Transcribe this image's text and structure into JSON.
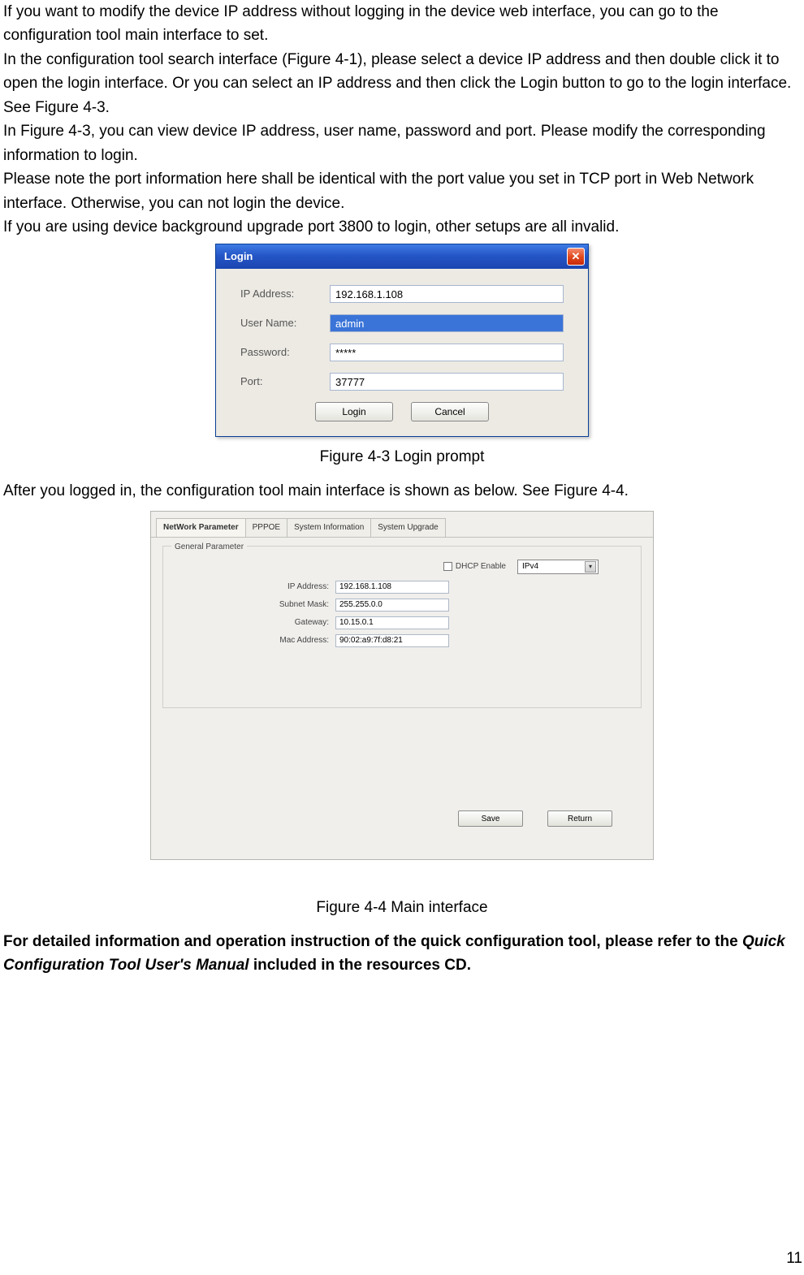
{
  "para1": "If you want to modify the device IP address without logging in the device web interface, you can go to the configuration tool main interface to set.",
  "para2": "In the configuration tool search interface (Figure 4-1), please select a device IP address and then double click it to open the login interface. Or you can select an IP address and then click the Login button to go to the login interface. See Figure 4-3.",
  "para3": "In Figure 4-3, you can view device IP address, user name, password and port. Please modify the corresponding information to login.",
  "para4": "Please note the port information here shall be identical with the port value you set in TCP port in Web Network interface. Otherwise, you can not login the device.",
  "para5": "If you are using device background upgrade port 3800 to login, other setups are all invalid.",
  "login": {
    "title": "Login",
    "labels": {
      "ip": "IP Address:",
      "user": "User Name:",
      "pass": "Password:",
      "port": "Port:"
    },
    "values": {
      "ip": "192.168.1.108",
      "user": "admin",
      "pass": "*****",
      "port": "37777"
    },
    "buttons": {
      "login": "Login",
      "cancel": "Cancel"
    },
    "close_glyph": "✕"
  },
  "caption43": "Figure 4-3 Login prompt",
  "para6": "After you logged in, the configuration tool main interface is shown as below. See Figure 4-4.",
  "cfg": {
    "tabs": [
      "NetWork Parameter",
      "PPPOE",
      "System Information",
      "System Upgrade"
    ],
    "group_title": "General Parameter",
    "dhcp_label": "DHCP Enable",
    "ipver": "IPv4",
    "labels": {
      "ip": "IP Address:",
      "mask": "Subnet Mask:",
      "gw": "Gateway:",
      "mac": "Mac Address:"
    },
    "values": {
      "ip": "192.168.1.108",
      "mask": "255.255.0.0",
      "gw": "10.15.0.1",
      "mac": "90:02:a9:7f:d8:21"
    },
    "buttons": {
      "save": "Save",
      "return": "Return"
    }
  },
  "caption44": "Figure 4-4 Main interface",
  "footer_a": "For detailed information and operation instruction of the quick configuration tool, please refer to the ",
  "footer_b": "Quick Configuration Tool User's Manual",
  "footer_c": " included in the resources CD.",
  "page_number": "11"
}
